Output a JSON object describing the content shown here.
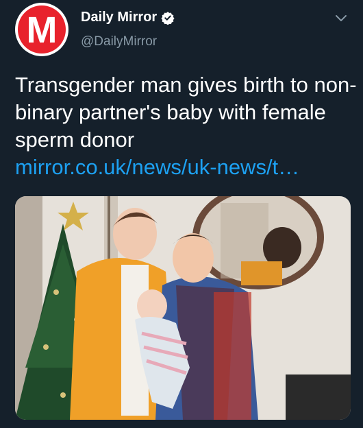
{
  "account": {
    "avatar_letter": "M",
    "display_name": "Daily Mirror",
    "handle": "@DailyMirror",
    "verified": true,
    "brand_color": "#e8222c"
  },
  "tweet": {
    "text": "Transgender man gives birth to non-binary partner's baby with female sperm donor",
    "link": "mirror.co.uk/news/uk-news/t…"
  },
  "icons": {
    "verified": "verified-badge-icon",
    "menu": "chevron-down-icon"
  },
  "colors": {
    "background": "#15202b",
    "link": "#1da1f2",
    "secondary_text": "#8899a6"
  }
}
